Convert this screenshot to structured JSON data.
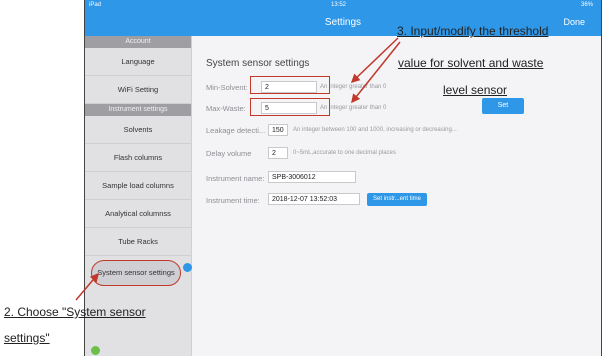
{
  "status": {
    "carrier": "iPad",
    "time": "13:52",
    "battery": "36%"
  },
  "nav": {
    "title": "Settings",
    "done": "Done"
  },
  "sidebar": {
    "account_header": "Account",
    "account_items": [
      {
        "label": "Language"
      },
      {
        "label": "WiFi Setting"
      }
    ],
    "instrument_header": "Instrument settings",
    "instrument_items": [
      {
        "label": "Solvents"
      },
      {
        "label": "Flash columns"
      },
      {
        "label": "Sample load columns"
      },
      {
        "label": "Analytical columnss"
      },
      {
        "label": "Tube Racks"
      }
    ],
    "selected_label": "System sensor settings"
  },
  "form": {
    "title": "System sensor settings",
    "min_solvent": {
      "label": "Min-Solvent:",
      "value": "2",
      "hint": "An integer greater than 0"
    },
    "max_waste": {
      "label": "Max-Waste:",
      "value": "5",
      "hint": "An integer greater than 0"
    },
    "set_label": "Set",
    "leakage": {
      "label": "Leakage detecti...",
      "value": "150",
      "hint": "An integer between 100 and 1000, increasing or decreasing..."
    },
    "delay": {
      "label": "Delay volume",
      "value": "2",
      "hint": "0~5mL,accurate to one decimal places"
    },
    "instrument_name": {
      "label": "Instrument name:",
      "value": "SPB-3006012"
    },
    "instrument_time": {
      "label": "Instrument time:",
      "value": "2018-12-07 13:52:03",
      "button": "Set instr...ent time"
    }
  },
  "annotations": {
    "step3_line1": "3. Input/modify the threshold",
    "step3_line2": "value for solvent and waste",
    "step3_line3": "level sensor",
    "step2_line1": "2. Choose \"System sensor",
    "step2_line2": "settings\""
  },
  "colors": {
    "accent": "#2f97e8",
    "annotation": "#c0392b"
  }
}
